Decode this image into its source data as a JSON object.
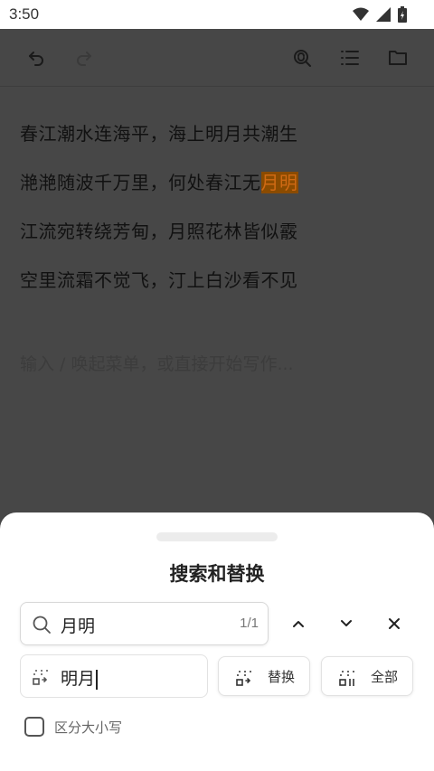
{
  "status": {
    "time": "3:50"
  },
  "editor": {
    "lines": [
      {
        "text": "春江潮水连海平，海上明月共潮生"
      },
      {
        "text": "滟滟随波千万里，何处春江无",
        "highlight": "月明"
      },
      {
        "text": "江流宛转绕芳甸，月照花林皆似霰"
      },
      {
        "text": "空里流霜不觉飞，汀上白沙看不见"
      }
    ],
    "placeholder": "输入 / 唤起菜单，或直接开始写作..."
  },
  "sheet": {
    "title": "搜索和替换",
    "search": {
      "value": "月明",
      "counter": "1/1"
    },
    "replace": {
      "value": "明月"
    },
    "replace_button": "替换",
    "replace_all_button": "全部",
    "case_sensitive_label": "区分大小写",
    "case_sensitive_checked": false
  },
  "colors": {
    "highlight_bg": "#8a4b00",
    "highlight_text": "#d06a14",
    "overlay": "#474747"
  }
}
